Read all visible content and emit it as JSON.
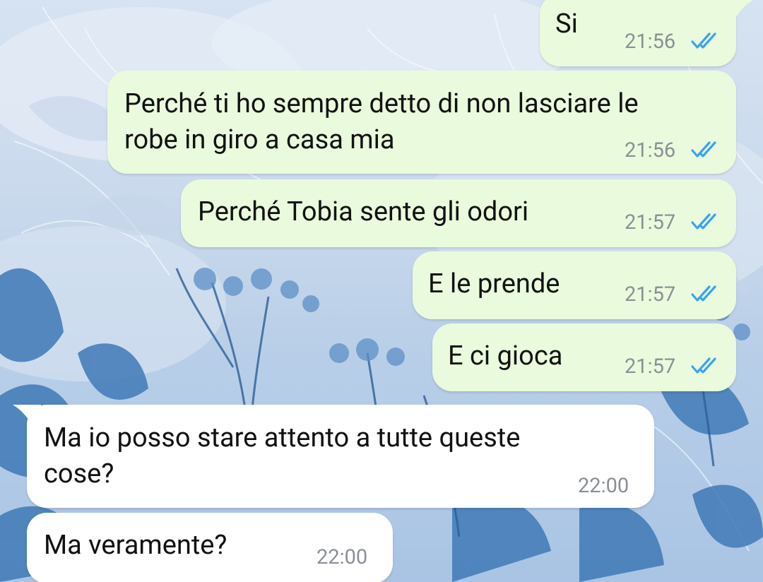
{
  "conversation": {
    "messages": [
      {
        "direction": "outgoing",
        "lines": [
          "Si"
        ],
        "time": "21:56",
        "status": "read"
      },
      {
        "direction": "outgoing",
        "lines": [
          "Perché ti ho sempre detto di non lasciare le",
          "robe in giro a casa mia"
        ],
        "time": "21:56",
        "status": "read"
      },
      {
        "direction": "outgoing",
        "lines": [
          "Perché Tobia sente gli odori"
        ],
        "time": "21:57",
        "status": "read"
      },
      {
        "direction": "outgoing",
        "lines": [
          "E le prende"
        ],
        "time": "21:57",
        "status": "read"
      },
      {
        "direction": "outgoing",
        "lines": [
          "E ci gioca"
        ],
        "time": "21:57",
        "status": "read"
      },
      {
        "direction": "incoming",
        "lines": [
          "Ma io posso stare attento a tutte queste",
          "cose?"
        ],
        "time": "22:00"
      },
      {
        "direction": "incoming",
        "lines": [
          "Ma veramente?"
        ],
        "time": "22:00"
      }
    ]
  },
  "theme": {
    "outgoing_bubble": "#e9fbdc",
    "incoming_bubble": "#ffffff",
    "read_tick_color": "#3ba3f0",
    "timestamp_color": "#8a8f95"
  },
  "icons": {
    "read_receipt": "double-check-icon",
    "wallpaper": "floral-wallpaper"
  }
}
